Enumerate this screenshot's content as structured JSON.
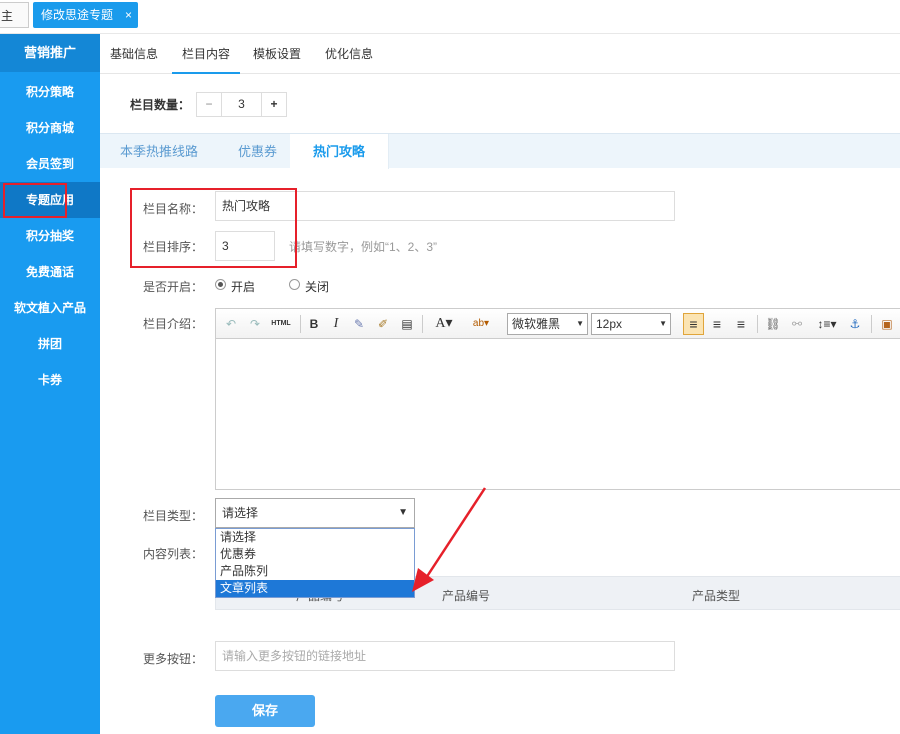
{
  "top_tabs": {
    "home": "主页",
    "active": "修改思途专题",
    "close": "×"
  },
  "sidebar": {
    "header": "营销推广",
    "items": [
      {
        "label": "积分策略"
      },
      {
        "label": "积分商城"
      },
      {
        "label": "会员签到"
      },
      {
        "label": "专题应用"
      },
      {
        "label": "积分抽奖"
      },
      {
        "label": "免费通话"
      },
      {
        "label": "软文植入产品"
      },
      {
        "label": "拼团"
      },
      {
        "label": "卡券"
      }
    ]
  },
  "sub_tabs": [
    "基础信息",
    "栏目内容",
    "模板设置",
    "优化信息"
  ],
  "column_count": {
    "label": "栏目数量：",
    "minus": "−",
    "value": "3",
    "plus": "+"
  },
  "column_tabs": [
    "本季热推线路",
    "优惠券",
    "热门攻略"
  ],
  "form": {
    "name_label": "栏目名称：",
    "name_value": "热门攻略",
    "order_label": "栏目排序：",
    "order_value": "3",
    "order_hint": "请填写数字，例如“1、2、3”",
    "enable_label": "是否开启：",
    "enable_on": "开启",
    "enable_off": "关闭",
    "intro_label": "栏目介绍：",
    "type_label": "栏目类型：",
    "type_selected": "请选择",
    "type_options": [
      "请选择",
      "优惠券",
      "产品陈列",
      "文章列表"
    ],
    "content_label": "内容列表：",
    "table_headers": [
      "产品编号",
      "产品编号",
      "产品类型"
    ],
    "more_label": "更多按钮：",
    "more_placeholder": "请输入更多按钮的链接地址",
    "save": "保存"
  },
  "editor": {
    "html_label": "HTML",
    "font": "微软雅黑",
    "size": "12px"
  },
  "colors": {
    "sidebar": "#199bf0",
    "accent": "#1a9bec",
    "annotation": "#e6202a"
  }
}
